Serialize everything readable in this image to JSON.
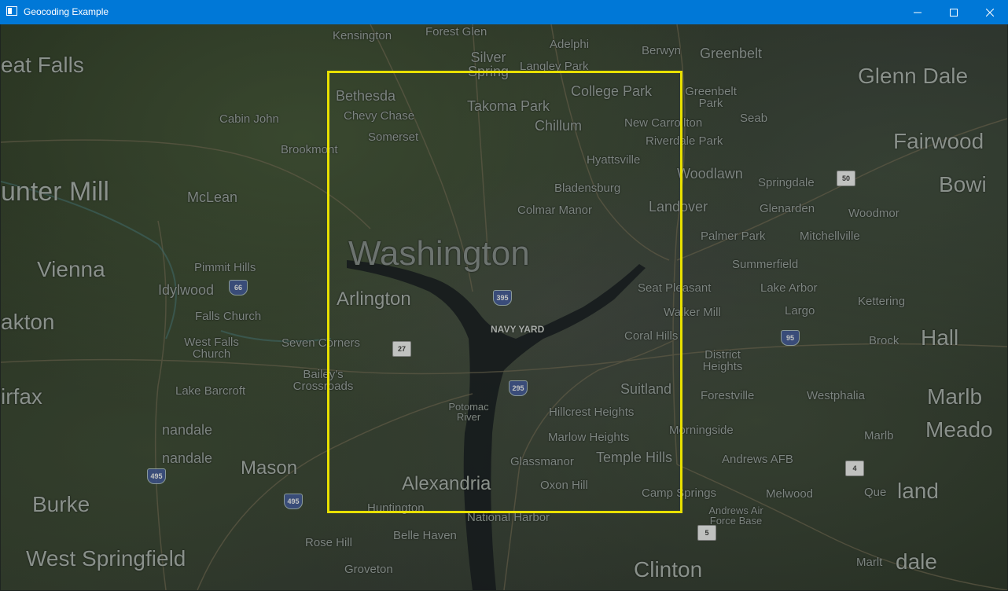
{
  "window": {
    "title": "Geocoding Example",
    "controls": {
      "minimize": "minimize-icon",
      "maximize": "maximize-icon",
      "close": "close-icon"
    },
    "titlebar_color": "#0078d7"
  },
  "map": {
    "highlight_color": "#e8e000",
    "labels": {
      "kensington": "Kensington",
      "forest_glen": "Forest Glen",
      "adelphi": "Adelphi",
      "berwyn": "Berwyn",
      "greenbelt": "Greenbelt",
      "great_falls": "eat Falls",
      "silver_spring": "Silver Spring",
      "langley_park": "Langley Park",
      "glenn_dale": "Glenn Dale",
      "bethesda": "Bethesda",
      "college_park": "College Park",
      "greenbelt_park": "Greenbelt Park",
      "chevy_chase": "Chevy Chase",
      "takoma_park": "Takoma Park",
      "cabin_john": "Cabin John",
      "chillum": "Chillum",
      "new_carrollton": "New Carrollton",
      "seabrook": "Seab",
      "somerset": "Somerset",
      "riverdale_park": "Riverdale Park",
      "brookmont": "Brookmont",
      "fairwood": "Fairwood",
      "hyattsville": "Hyattsville",
      "hunter_mill": "unter Mill",
      "mclean": "McLean",
      "woodlawn": "Woodlawn",
      "bladensburg": "Bladensburg",
      "springdale": "Springdale",
      "bowie": "Bowi",
      "landover": "Landover",
      "glenarden": "Glenarden",
      "woodmore": "Woodmor",
      "colmar_manor": "Colmar Manor",
      "washington": "Washington",
      "palmer_park": "Palmer Park",
      "mitchellville": "Mitchellville",
      "vienna": "Vienna",
      "pimmit_hills": "Pimmit Hills",
      "summerfield": "Summerfield",
      "idylwood": "Idylwood",
      "arlington": "Arlington",
      "seat_pleasant": "Seat Pleasant",
      "lake_arbor": "Lake Arbor",
      "kettering": "Kettering",
      "oakton": "akton",
      "falls_church": "Falls Church",
      "walker_mill": "Walker Mill",
      "largo": "Largo",
      "navy_yard": "NAVY YARD",
      "west_falls_church": "West Falls Church",
      "seven_corners": "Seven Corners",
      "coral_hills": "Coral Hills",
      "brock": "Brock",
      "hall": "Hall",
      "district_heights": "District Heights",
      "baileys_crossroads": "Bailey's Crossroads",
      "suitland": "Suitland",
      "lake_barcroft": "Lake Barcroft",
      "forestville": "Forestville",
      "westphalia": "Westphalia",
      "fairfax": "irfax",
      "marlboro": "Marlb",
      "potomac_river": "Potomac River",
      "hillcrest_heights": "Hillcrest Heights",
      "annandale1": "nandale",
      "annandale2": "nandale",
      "morningside": "Morningside",
      "marlton": "Marlb",
      "meadows": "Meado",
      "marlow_heights": "Marlow Heights",
      "temple_hills": "Temple Hills",
      "andrews_afb": "Andrews AFB",
      "mason": "Mason",
      "glassmanor": "Glassmanor",
      "burke": "Burke",
      "alexandria": "Alexandria",
      "oxon_hill": "Oxon Hill",
      "melwood": "Melwood",
      "queensland": "Que",
      "upland": "land",
      "camp_springs": "Camp Springs",
      "huntington": "Huntington",
      "national_harbor": "National Harbor",
      "andrews_afb_base": "Andrews Air Force Base",
      "rose_hill": "Rose Hill",
      "belle_haven": "Belle Haven",
      "west_springfield": "West Springfield",
      "groveton": "Groveton",
      "clinton": "Clinton",
      "marlton2": "Marlt",
      "dale": "dale"
    },
    "shields": {
      "i66": "66",
      "i495a": "495",
      "i295": "295",
      "r27": "27",
      "i95": "95",
      "r50": "50",
      "r4": "4",
      "r5": "5",
      "i395": "395",
      "i495b": "495"
    }
  }
}
